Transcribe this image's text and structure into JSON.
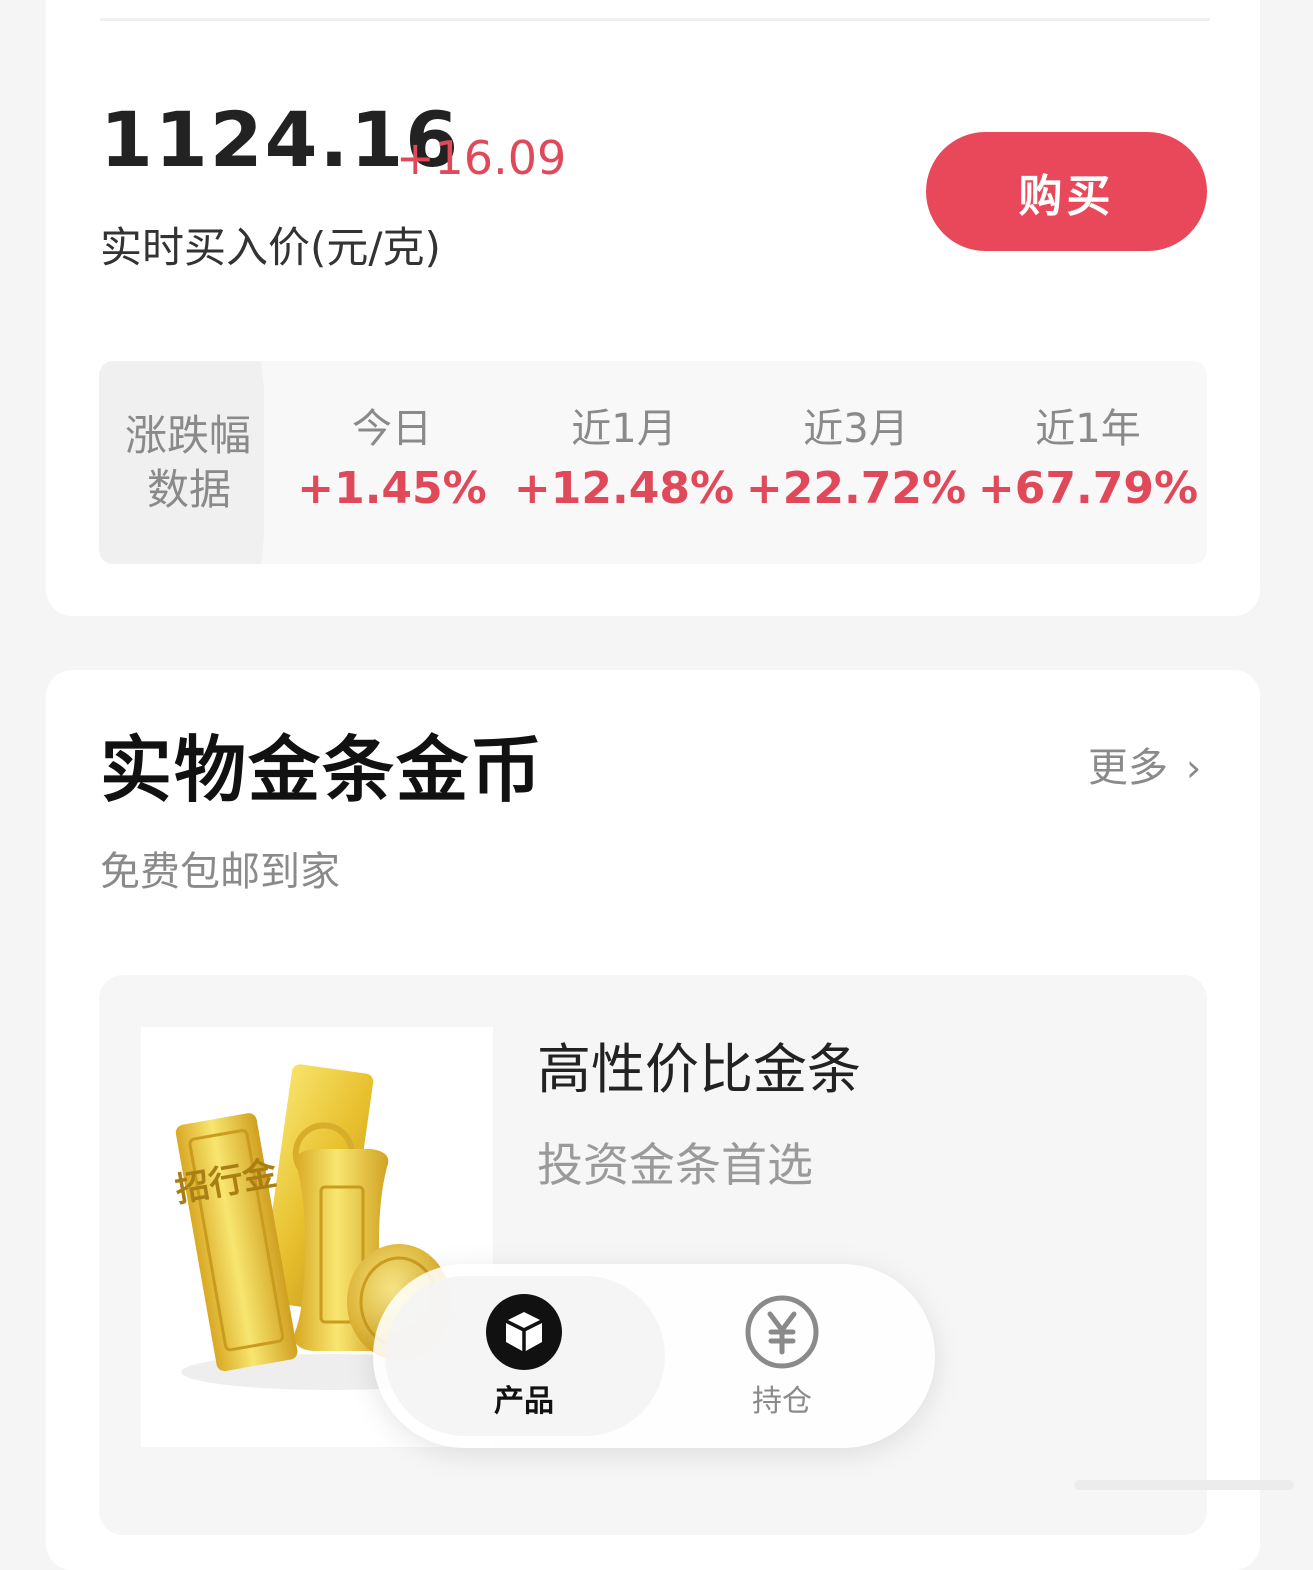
{
  "price": {
    "value": "1124.16",
    "change": "+16.09",
    "label": "实时买入价(元/克)",
    "buy_label": "购买"
  },
  "stats": {
    "header_line1": "涨跌幅",
    "header_line2": "数据",
    "periods": [
      {
        "label": "今日",
        "value": "+1.45%"
      },
      {
        "label": "近1月",
        "value": "+12.48%"
      },
      {
        "label": "近3月",
        "value": "+22.72%"
      },
      {
        "label": "近1年",
        "value": "+67.79%"
      }
    ]
  },
  "section": {
    "title": "实物金条金币",
    "more_label": "更多",
    "subtitle": "免费包邮到家"
  },
  "product": {
    "name": "高性价比金条",
    "desc": "投资金条首选",
    "bar_text": "招行金",
    "image": "gold-bars-image"
  },
  "nav": {
    "items": [
      {
        "label": "产品",
        "icon": "box-icon",
        "active": true
      },
      {
        "label": "持仓",
        "icon": "yen-icon",
        "active": false
      }
    ]
  },
  "colors": {
    "accent_red": "#e8485a",
    "rise_red": "#e0495a",
    "gold": "#e8c12f"
  }
}
